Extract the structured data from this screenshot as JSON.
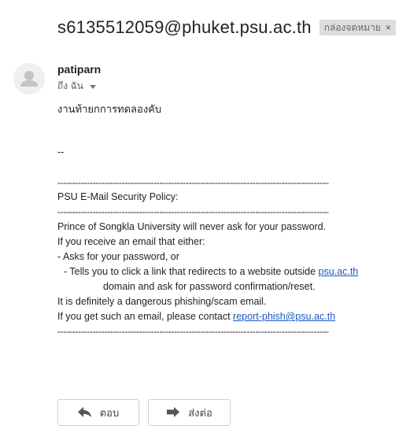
{
  "email": {
    "subject": "s6135512059@phuket.psu.ac.th",
    "label_chip": "กล่องจดหมาย",
    "label_chip_close": "×",
    "sender_name": "patiparn",
    "to_text": "ถึง ฉัน",
    "body_text": "งานท้ายกการทดลองคับ",
    "signature_sep": "--"
  },
  "policy": {
    "rule": "------------------------------------------------------------------------------------------------------",
    "title": "PSU E-Mail Security Policy:",
    "line1": "Prince of Songkla University will never ask for your password.",
    "line2": "If you receive an email that either:",
    "line3": "- Asks for your password, or",
    "line4_prefix": "- Tells you to click a link that redirects to a website outside ",
    "line4_link": "psu.ac.th",
    "line5": "domain and ask for password confirmation/reset.",
    "line6": "It is definitely a dangerous phishing/scam email.",
    "line7_prefix": "If you get such an email, please contact ",
    "line7_link": "report-phish@psu.ac.th"
  },
  "actions": {
    "reply_label": "ตอบ",
    "forward_label": "ส่งต่อ"
  },
  "icons": {
    "avatar": "person-icon",
    "reply": "reply-arrow-icon",
    "forward": "forward-arrow-icon"
  }
}
